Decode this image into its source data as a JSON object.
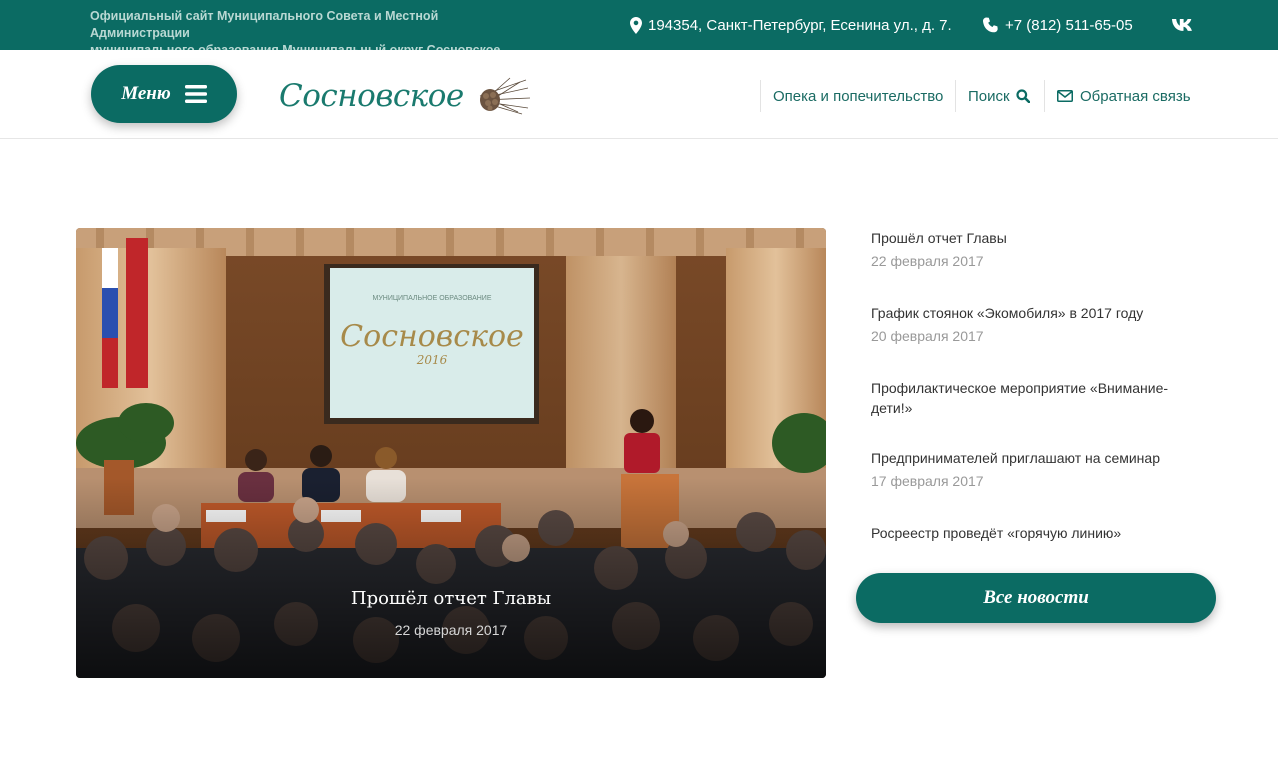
{
  "topbar": {
    "site_desc_line1": "Официальный сайт Муниципального Совета и Местной Администрации",
    "site_desc_line2": "муниципального образования Муниципальный округ Сосновское",
    "address": "194354, Санкт-Петербург, Есенина ул., д. 7.",
    "phone": "+7 (812) 511-65-05",
    "social": "vk"
  },
  "header": {
    "menu_label": "Меню",
    "logo_text": "Сосновское",
    "nav": [
      {
        "label": "Опека и попечительство"
      },
      {
        "label": "Поиск"
      },
      {
        "label": "Обратная связь"
      }
    ]
  },
  "feature": {
    "title": "Прошёл отчет Главы",
    "date": "22 февраля 2017",
    "screen_caption": "МУНИЦИПАЛЬНОЕ ОБРАЗОВАНИЕ",
    "screen_title": "Сосновское",
    "screen_year": "2016"
  },
  "news": {
    "items": [
      {
        "title": "Прошёл отчет Главы",
        "date": "22 февраля 2017"
      },
      {
        "title": "График стоянок «Экомобиля» в 2017 году",
        "date": "20 февраля 2017"
      },
      {
        "title": "Профилактическое мероприятие «Внимание-дети!»",
        "date": ""
      },
      {
        "title": "Предпринимателей приглашают на семинар",
        "date": "17 февраля 2017"
      },
      {
        "title": "Росреестр проведёт «горячую линию»",
        "date": ""
      }
    ],
    "all_label": "Все новости"
  },
  "colors": {
    "brand": "#0b6b63",
    "muted_text": "#999999"
  }
}
